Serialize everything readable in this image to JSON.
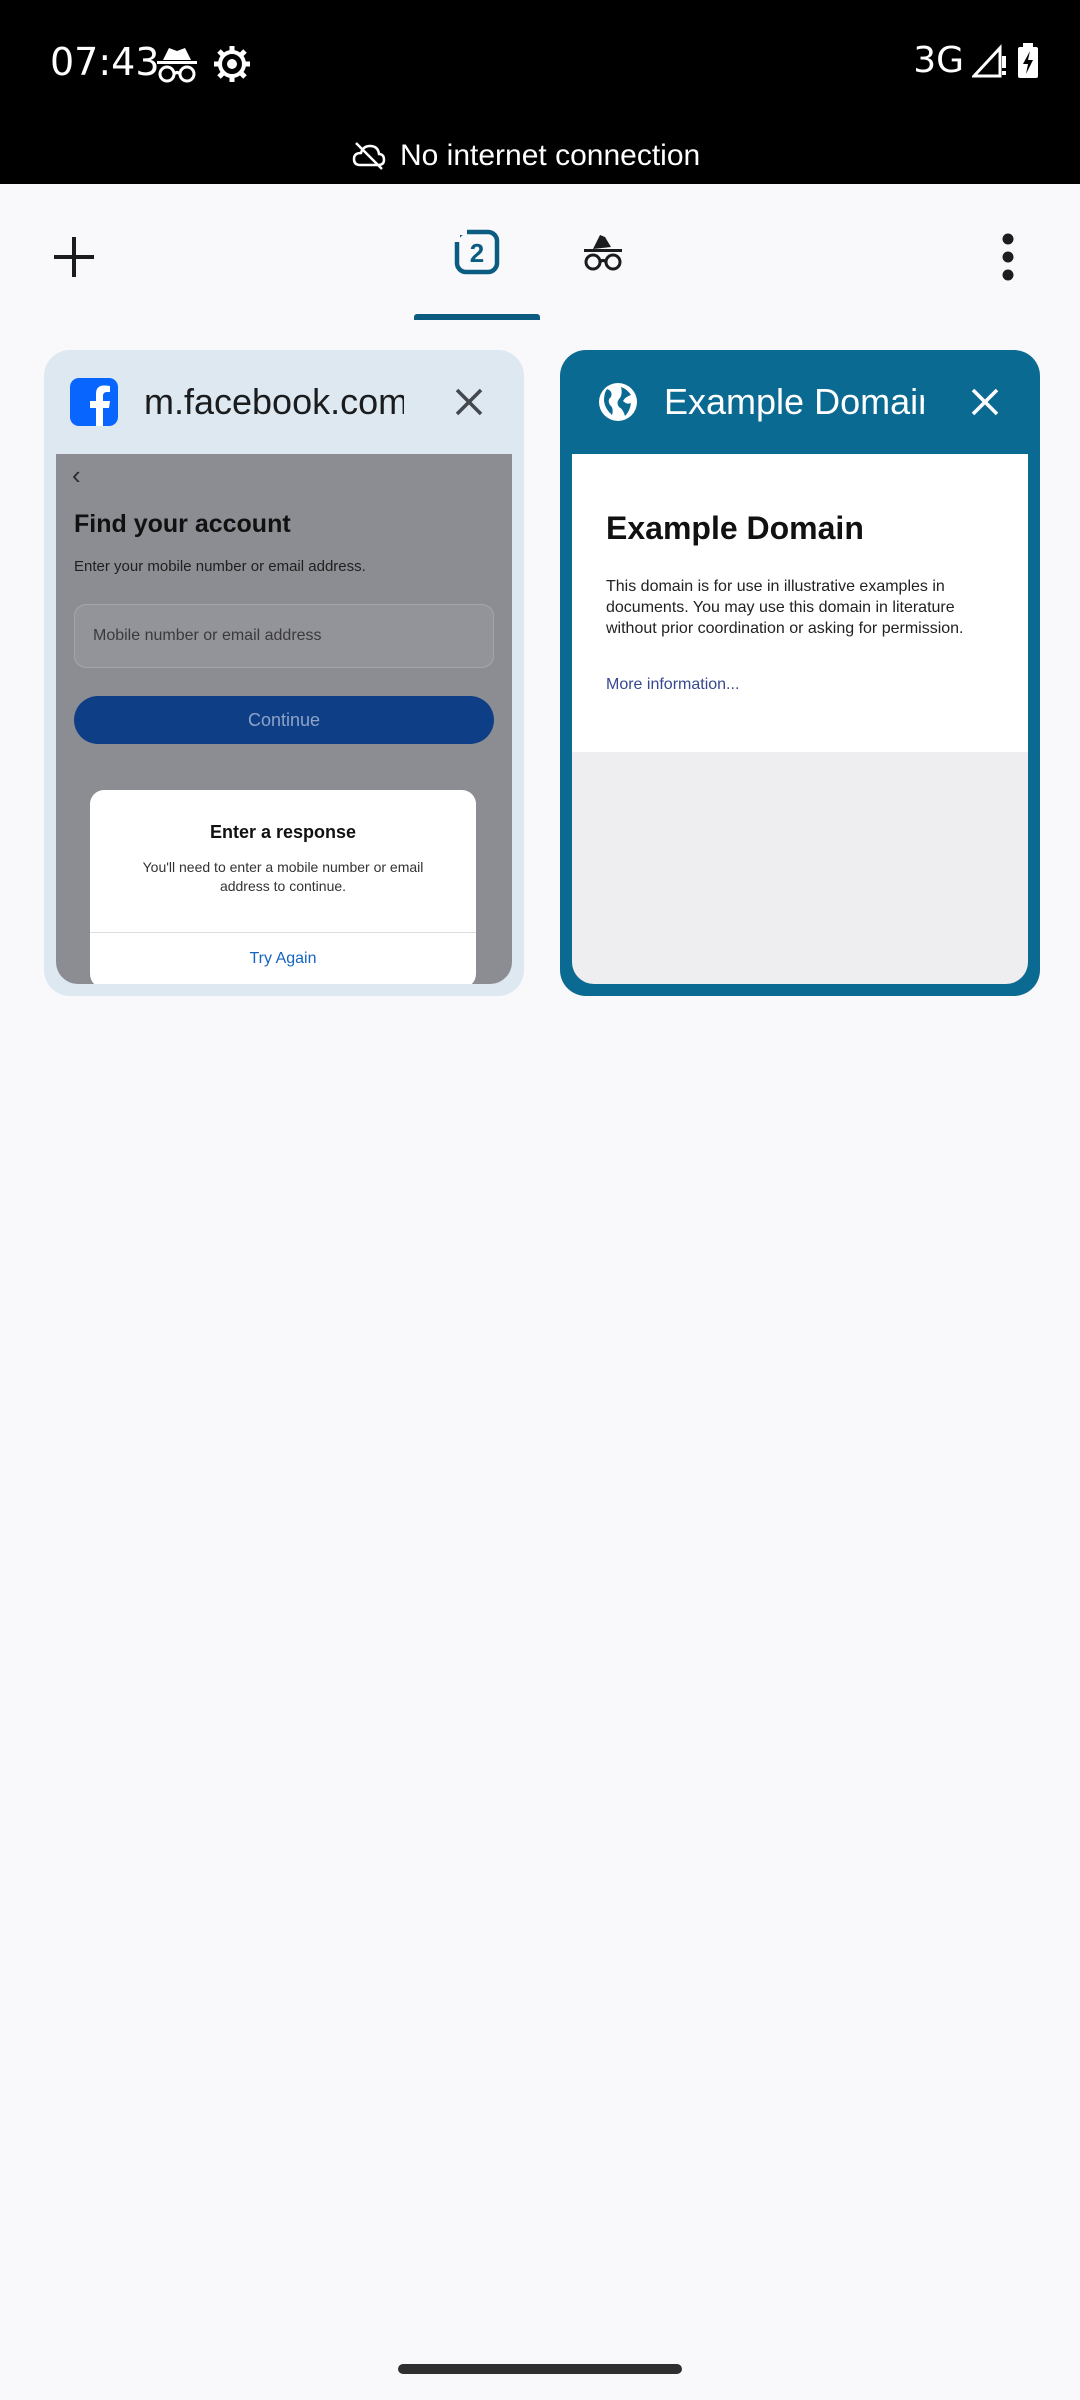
{
  "status_bar": {
    "time": "07:43",
    "network": "3G",
    "icons": [
      "incognito-icon",
      "gear-icon",
      "signal-icon",
      "battery-charging-icon"
    ]
  },
  "offline_banner": {
    "text": "No internet connection",
    "icon": "cloud-off-icon"
  },
  "toolbar": {
    "new_tab_icon": "plus-icon",
    "normal_tabs_count": "2",
    "incognito_icon": "incognito-icon",
    "menu_icon": "more-vert-icon",
    "accent_color": "#0b5c80"
  },
  "tabs": [
    {
      "title": "m.facebook.com",
      "favicon": "facebook-icon",
      "thumbnail": {
        "heading": "Find your account",
        "subheading": "Enter your mobile number or email address.",
        "input_placeholder": "Mobile number or email address",
        "button": "Continue",
        "dialog_title": "Enter a response",
        "dialog_body": "You'll need to enter a mobile number or email address to continue.",
        "dialog_button": "Try Again"
      }
    },
    {
      "title": "Example Domain",
      "favicon": "globe-icon",
      "selected": true,
      "thumbnail": {
        "heading": "Example Domain",
        "body": "This domain is for use in illustrative examples in documents. You may use this domain in literature without prior coordination or asking for permission.",
        "link": "More information..."
      }
    }
  ]
}
